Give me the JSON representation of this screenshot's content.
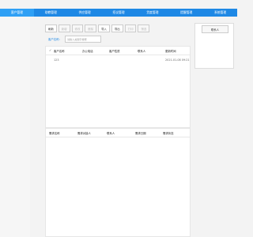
{
  "nav": {
    "items": [
      {
        "label": "客户管理",
        "active": true
      },
      {
        "label": "助教管理",
        "active": false
      },
      {
        "label": "供应管理",
        "active": false
      },
      {
        "label": "招议管理",
        "active": false
      },
      {
        "label": "货度管理",
        "active": false
      },
      {
        "label": "提醒管理",
        "active": false
      },
      {
        "label": "系统管理",
        "active": false
      }
    ]
  },
  "toolbar": {
    "buttons": [
      {
        "label": "刷新",
        "enabled": true
      },
      {
        "label": "新增",
        "enabled": false
      },
      {
        "label": "修改",
        "enabled": false
      },
      {
        "label": "删除",
        "enabled": false
      },
      {
        "label": "导入",
        "enabled": true
      },
      {
        "label": "导出",
        "enabled": true
      },
      {
        "label": "打印",
        "enabled": false
      },
      {
        "label": "筛选",
        "enabled": false
      }
    ]
  },
  "filter": {
    "label": "客户名称：",
    "placeholder": "请输入关键字搜索"
  },
  "top_table": {
    "headers": [
      "客户名称",
      "办公电话",
      "客户性质",
      "联系人",
      "更新时间"
    ],
    "rows": [
      {
        "col1": "123",
        "col2": "",
        "col3": "",
        "col4": "",
        "col5": "2021-01-08 09:21"
      }
    ]
  },
  "bottom_table": {
    "headers": [
      "需求名称",
      "需求对接人",
      "联系人",
      "需求日期",
      "需求状态"
    ]
  },
  "right_panel": {
    "button_label": "联系人"
  },
  "colors": {
    "nav_bg": "#1e88e5",
    "nav_active": "#2fa0f5"
  }
}
